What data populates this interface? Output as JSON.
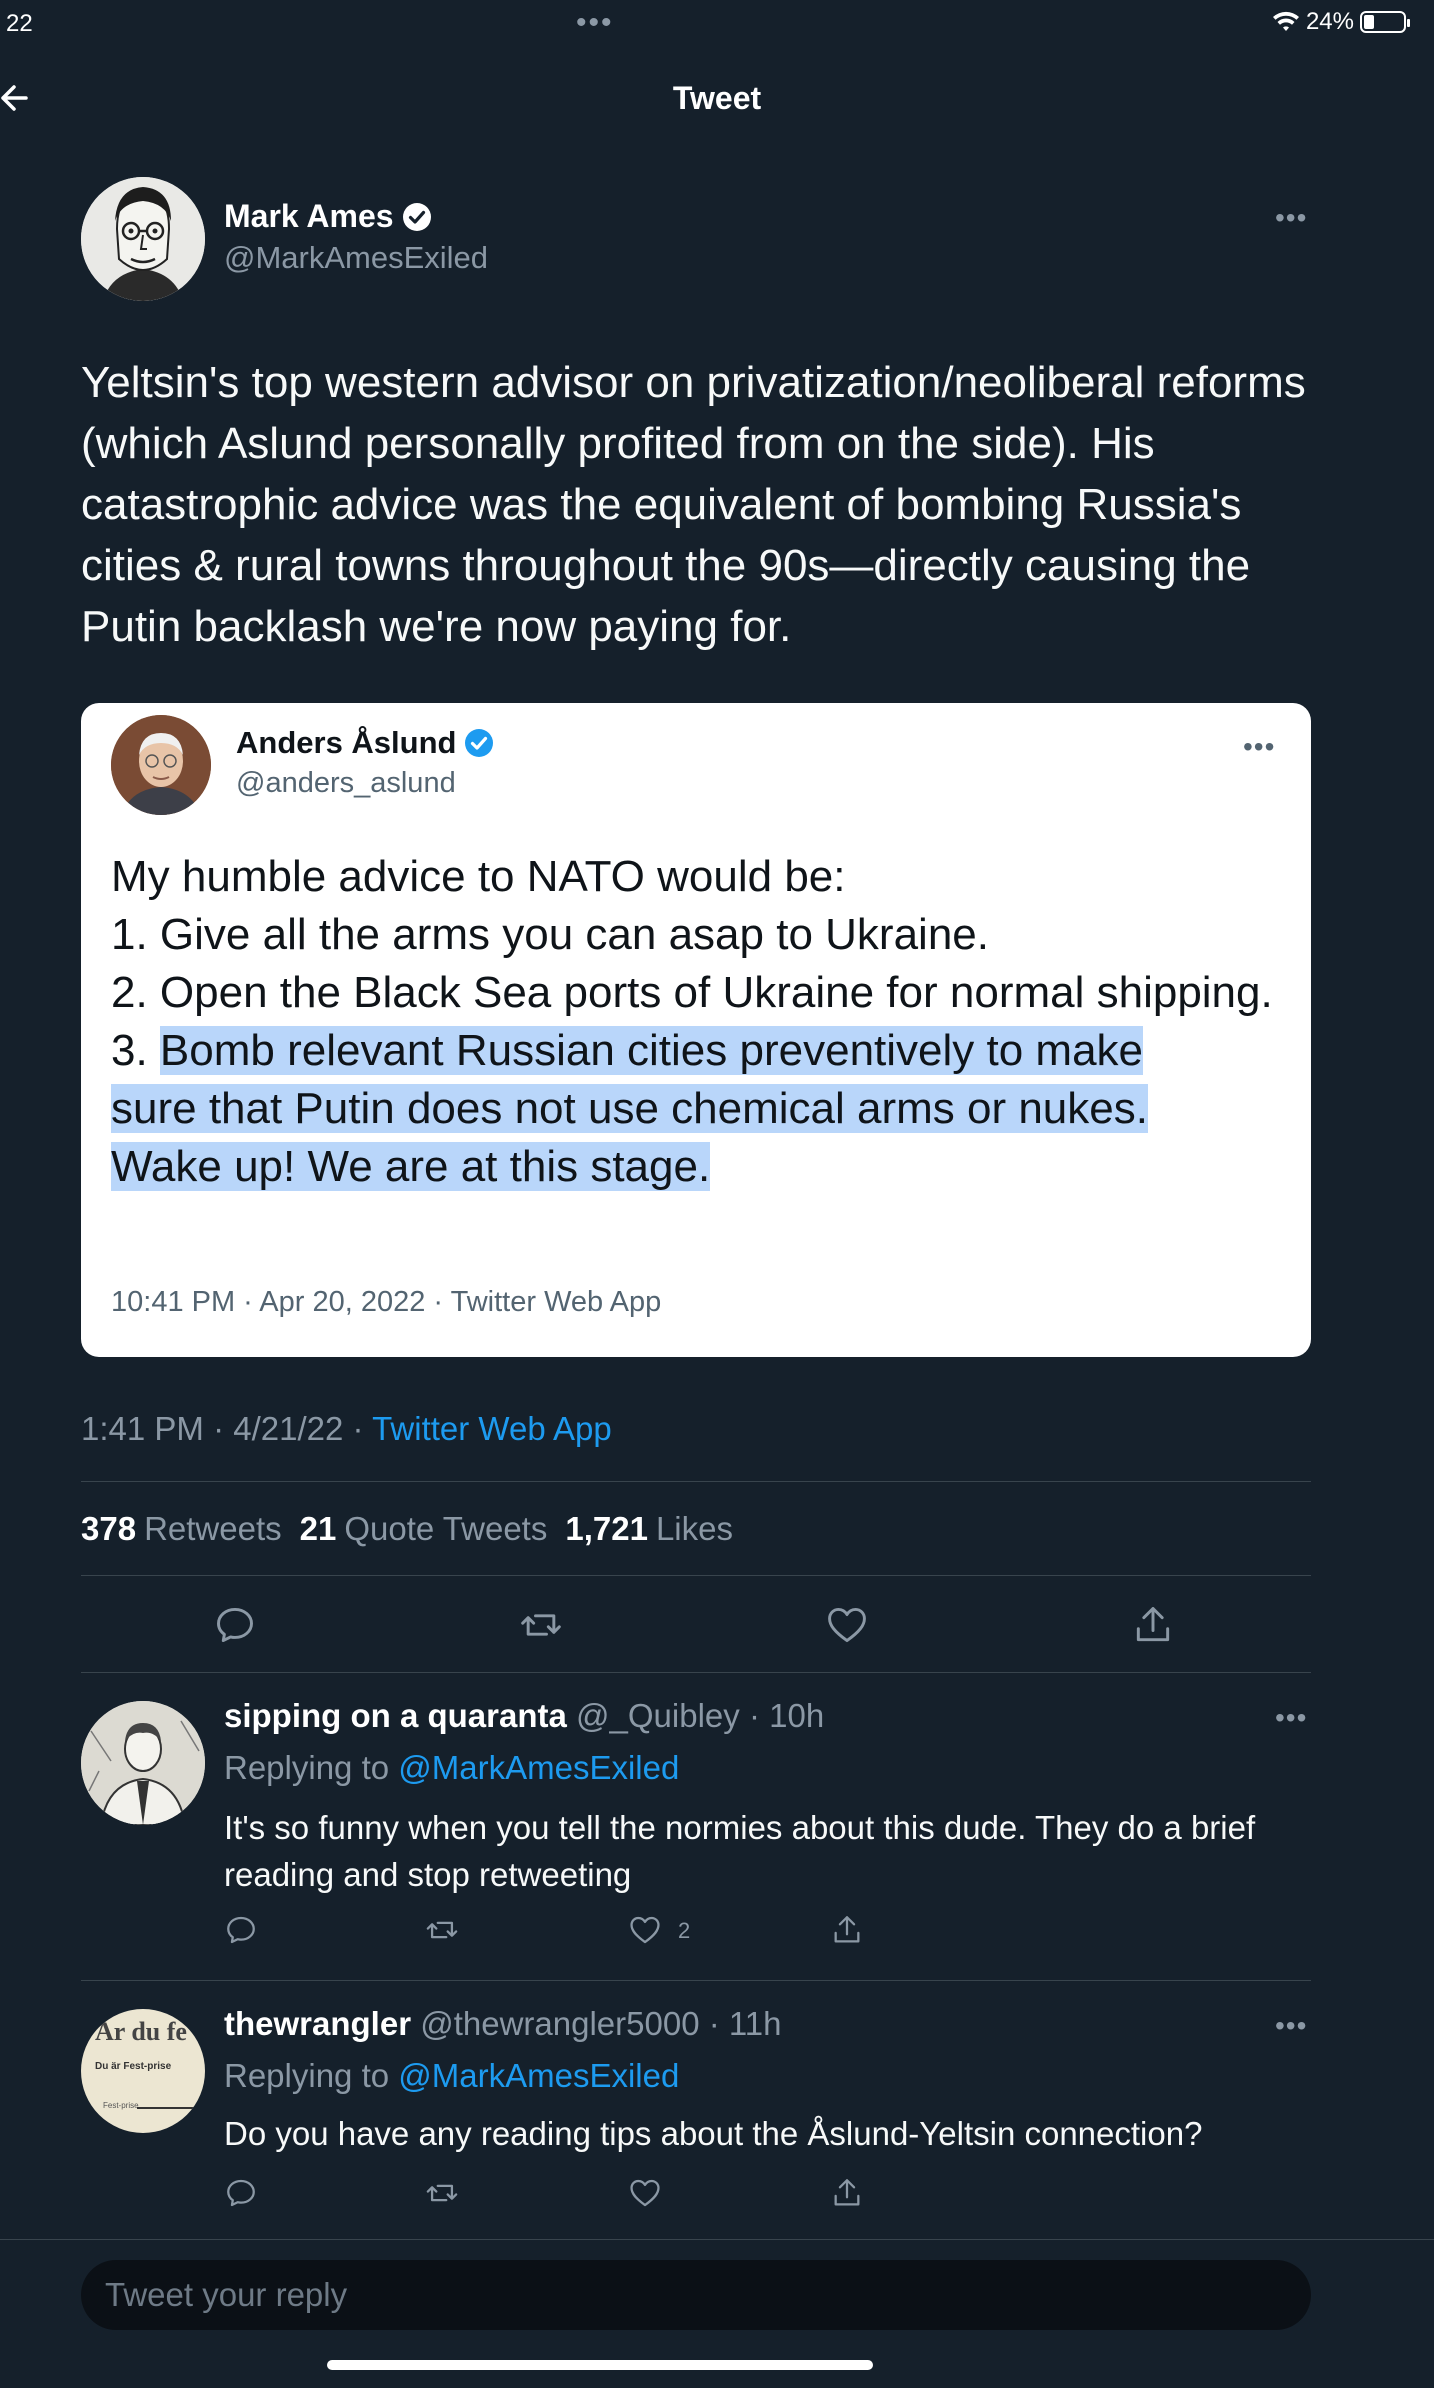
{
  "status_bar": {
    "time": "22",
    "battery_pct": "24%"
  },
  "header": {
    "title": "Tweet"
  },
  "main_tweet": {
    "name": "Mark Ames",
    "handle": "@MarkAmesExiled",
    "text": "Yeltsin's top western advisor on privatization/neoliberal reforms (which Aslund personally profited from on the side). His catastrophic advice was the equivalent of bombing Russia's cities & rural towns throughout the 90s—directly causing the Putin backlash we're now paying for.",
    "time_date": "1:41 PM · 4/21/22 · ",
    "source": "Twitter Web App"
  },
  "quoted_tweet": {
    "name": "Anders Åslund",
    "handle": "@anders_aslund",
    "line1": "My humble advice to NATO would be:",
    "line2": "1. Give all the arms you can asap to Ukraine.",
    "line3": "2. Open the Black Sea ports of Ukraine for normal shipping.",
    "line4_prefix": "3. ",
    "line4_highlight_a": "Bomb relevant Russian cities preventively to make",
    "line4_highlight_b": "sure that Putin does not use chemical arms or nukes.",
    "line4_highlight_c": "Wake up! We are at this stage.",
    "meta": "10:41 PM · Apr 20, 2022 · Twitter Web App"
  },
  "stats": {
    "retweets_count": "378",
    "retweets_label": "Retweets",
    "quotes_count": "21",
    "quotes_label": "Quote Tweets",
    "likes_count": "1,721",
    "likes_label": "Likes"
  },
  "replies": [
    {
      "name": "sipping on a quaranta",
      "handle": "@_Quibley",
      "time": "· 10h",
      "replying_label": "Replying to ",
      "replying_to": "@MarkAmesExiled",
      "text": "It's so funny when you tell the normies about this dude. They do a brief reading and stop retweeting",
      "like_count": "2"
    },
    {
      "name": "thewrangler",
      "handle": "@thewrangler5000",
      "time": "· 11h",
      "replying_label": "Replying to ",
      "replying_to": "@MarkAmesExiled",
      "text": "Do you have any reading tips about the Åslund-Yeltsin connection?",
      "avatar_text_1": "Ar du fe",
      "avatar_text_2": "Du är Fest-prise",
      "avatar_text_3": "Fest-prise"
    }
  ],
  "reply_box": {
    "placeholder": "Tweet your reply"
  },
  "colors": {
    "background": "#15202b",
    "accent": "#1d9bf0",
    "muted": "#8b98a5",
    "highlight": "#b9d6fa"
  }
}
